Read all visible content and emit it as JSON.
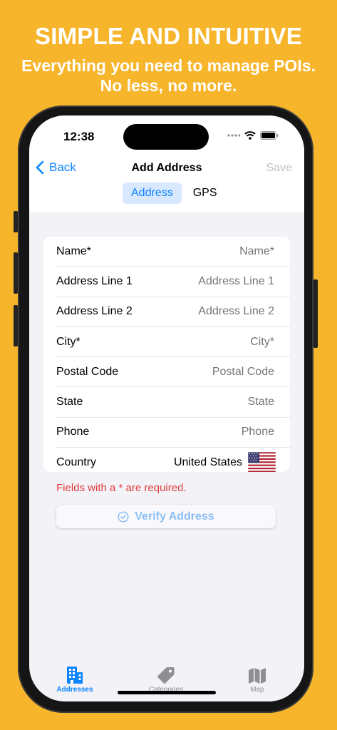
{
  "promo": {
    "title": "SIMPLE AND INTUITIVE",
    "subtitle_line1": "Everything you need to manage POIs.",
    "subtitle_line2": "No less, no more."
  },
  "status": {
    "time": "12:38"
  },
  "nav": {
    "back": "Back",
    "title": "Add Address",
    "save": "Save"
  },
  "segment": {
    "active": "Address",
    "inactive": "GPS"
  },
  "form": {
    "rows": [
      {
        "label": "Name*",
        "placeholder": "Name*"
      },
      {
        "label": "Address Line 1",
        "placeholder": "Address Line 1"
      },
      {
        "label": "Address Line 2",
        "placeholder": "Address Line 2"
      },
      {
        "label": "City*",
        "placeholder": "City*"
      },
      {
        "label": "Postal Code",
        "placeholder": "Postal Code"
      },
      {
        "label": "State",
        "placeholder": "State"
      },
      {
        "label": "Phone",
        "placeholder": "Phone"
      }
    ],
    "country_label": "Country",
    "country_value": "United States"
  },
  "required_note": "Fields with a * are required.",
  "verify_label": "Verify Address",
  "tabs": [
    {
      "label": "Addresses",
      "icon": "building-icon"
    },
    {
      "label": "Categories",
      "icon": "tag-icon"
    },
    {
      "label": "Map",
      "icon": "map-icon"
    }
  ],
  "colors": {
    "background": "#F7B52C",
    "accent": "#0A84FF",
    "error": "#E23B3B"
  }
}
